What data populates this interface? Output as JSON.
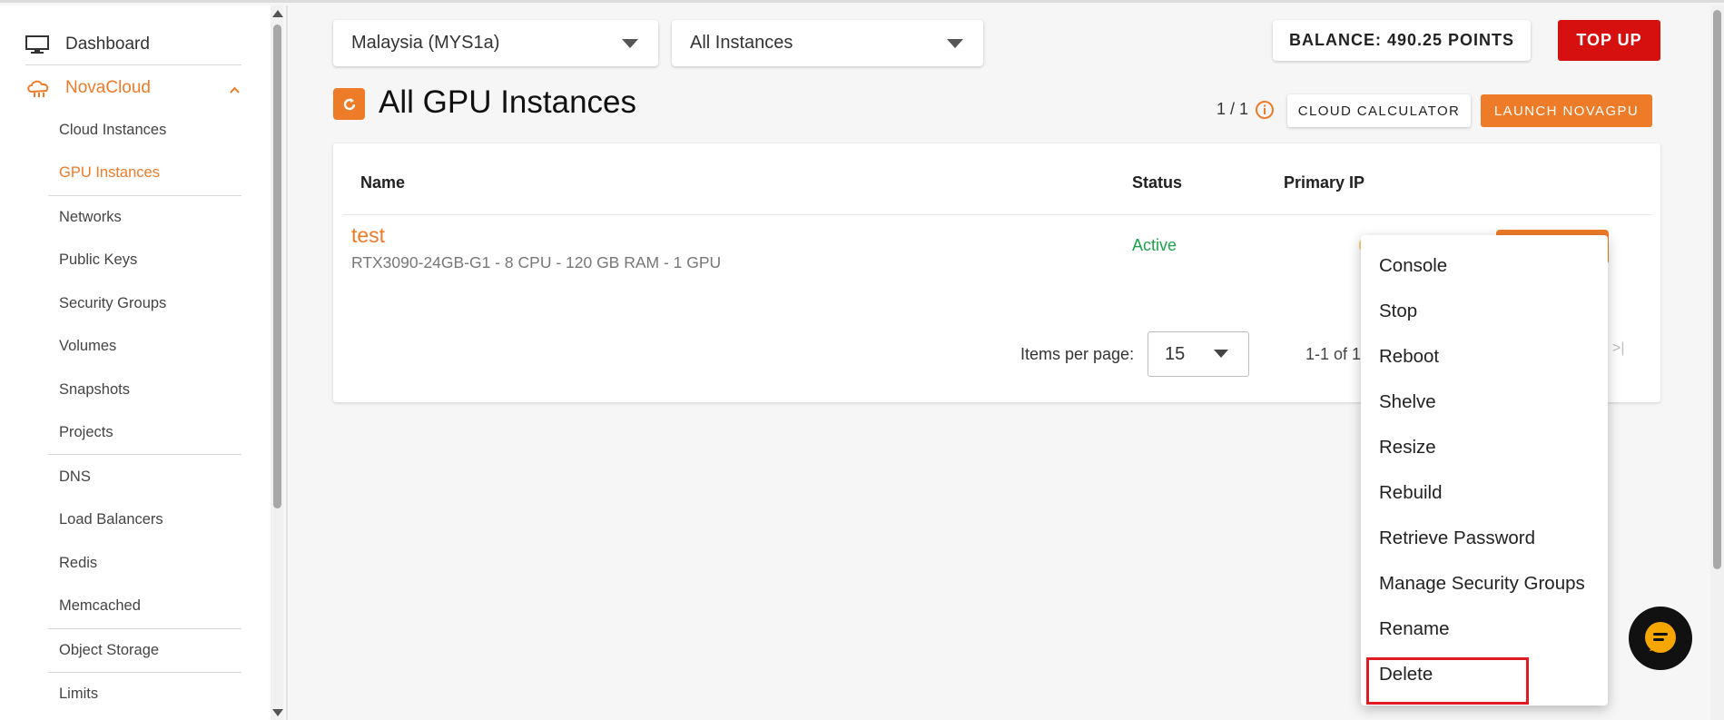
{
  "sidebar": {
    "dashboard": "Dashboard",
    "product": "NovaCloud",
    "items": [
      {
        "label": "Cloud Instances"
      },
      {
        "label": "GPU Instances"
      },
      {
        "label": "Networks"
      },
      {
        "label": "Public Keys"
      },
      {
        "label": "Security Groups"
      },
      {
        "label": "Volumes"
      },
      {
        "label": "Snapshots"
      },
      {
        "label": "Projects"
      },
      {
        "label": "DNS"
      },
      {
        "label": "Load Balancers"
      },
      {
        "label": "Redis"
      },
      {
        "label": "Memcached"
      },
      {
        "label": "Object Storage"
      },
      {
        "label": "Limits"
      }
    ],
    "active_item": "GPU Instances",
    "accent_color": "#ee7b27"
  },
  "toolbar": {
    "region_select": "Malaysia (MYS1a)",
    "instance_filter": "All Instances",
    "balance": "BALANCE: 490.25 POINTS",
    "topup_label": "TOP UP"
  },
  "header": {
    "title": "All GPU Instances",
    "counter": "1 / 1",
    "calculator_label": "CLOUD CALCULATOR",
    "launch_label": "LAUNCH NOVAGPU"
  },
  "table": {
    "columns": [
      "Name",
      "Status",
      "Primary IP"
    ],
    "rows": [
      {
        "name": "test",
        "spec": "RTX3090-24GB-G1 - 8 CPU - 120 GB RAM - 1 GPU",
        "status": "Active"
      }
    ],
    "status_color": "#1aa34a"
  },
  "pagination": {
    "items_per_page_label": "Items per page:",
    "items_per_page_value": "15",
    "range_text": "1-1 of 1",
    "last_page_icon": ">|"
  },
  "context_menu": {
    "items": [
      {
        "label": "Console"
      },
      {
        "label": "Stop"
      },
      {
        "label": "Reboot"
      },
      {
        "label": "Shelve"
      },
      {
        "label": "Resize"
      },
      {
        "label": "Rebuild"
      },
      {
        "label": "Retrieve Password"
      },
      {
        "label": "Manage Security Groups"
      },
      {
        "label": "Rename"
      },
      {
        "label": "Delete"
      }
    ],
    "highlighted": "Delete",
    "highlight_color": "#e01b24"
  },
  "icons": {
    "dashboard": "monitor-icon",
    "product": "cloud-icon",
    "refresh": "refresh-icon",
    "info": "info-icon",
    "chat": "chat-icon"
  },
  "colors": {
    "primary": "#ee7b27",
    "topup": "#d60f0f"
  }
}
